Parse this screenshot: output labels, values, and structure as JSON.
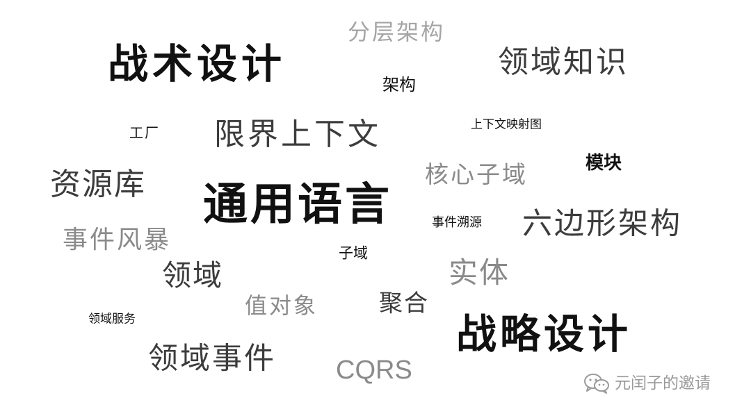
{
  "words": {
    "fenceng_jiagou": "分层架构",
    "zhanshu_sheji": "战术设计",
    "lingyu_zhishi": "领域知识",
    "jiagou": "架构",
    "gongchang": "工厂",
    "xianjie_shangxiawen": "限界上下文",
    "shangxiawen_yingshetu": "上下文映射图",
    "mokuai": "模块",
    "ziyuanku": "资源库",
    "hexin_ziyu": "核心子域",
    "tongyong_yuyan": "通用语言",
    "shijian_suyuan": "事件溯源",
    "liubianxing_jiagou": "六边形架构",
    "shijian_fengbao": "事件风暴",
    "ziyu": "子域",
    "shiti": "实体",
    "lingyu": "领域",
    "zhiduixiang": "值对象",
    "juhe": "聚合",
    "lingyu_fuwu": "领域服务",
    "zhanlue_sheji": "战略设计",
    "lingyu_shijian": "领域事件",
    "cqrs": "CQRS"
  },
  "watermark": {
    "icon": "wechat-icon",
    "text": "元闰子的邀请"
  },
  "colors": {
    "black": "#111111",
    "dark": "#3c3c3c",
    "gray": "#8a8a8a",
    "light": "#a5a5a5",
    "background": "#ffffff"
  }
}
